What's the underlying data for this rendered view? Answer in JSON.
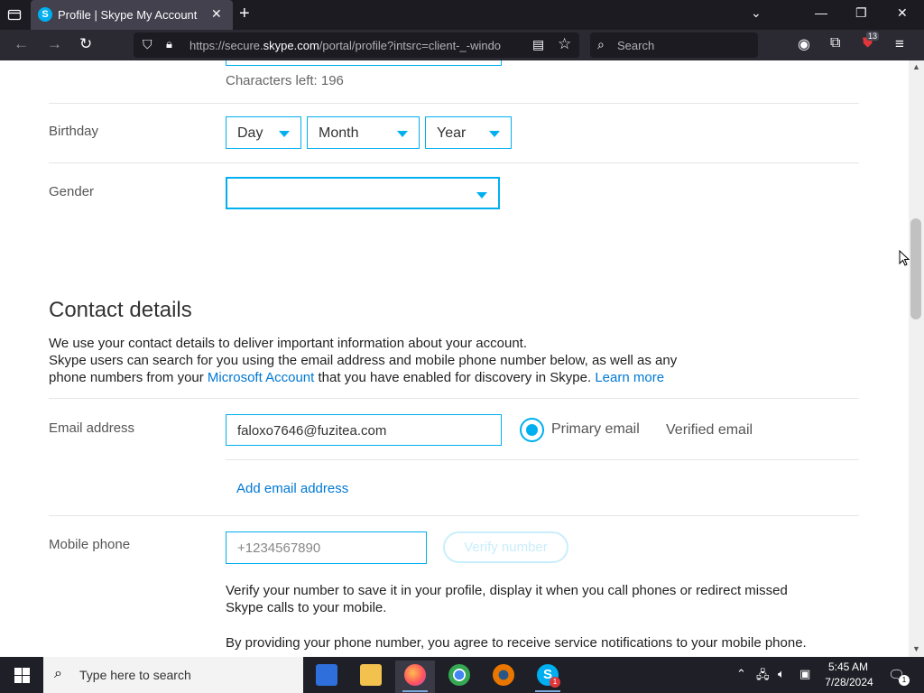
{
  "browser": {
    "tab_title": "Profile | Skype My Account",
    "url_prefix": "https://secure.",
    "url_domain": "skype.com",
    "url_suffix": "/portal/profile?intsrc=client-_-windo",
    "search_placeholder": "Search",
    "extension_badge": "13"
  },
  "profile": {
    "characters_left": "Characters left: 196",
    "birthday_label": "Birthday",
    "birthday_day": "Day",
    "birthday_month": "Month",
    "birthday_year": "Year",
    "gender_label": "Gender",
    "gender_value": ""
  },
  "contact": {
    "heading": "Contact details",
    "line1": "We use your contact details to deliver important information about your account.",
    "line2": "Skype users can search for you using the email address and mobile phone number below, as well as any",
    "line3_pre": "phone numbers from your ",
    "line3_link": "Microsoft Account",
    "line3_mid": " that you have enabled for discovery in Skype. ",
    "line3_link2": "Learn more",
    "email_label": "Email address",
    "email_value": "faloxo7646@fuzitea.com",
    "primary_email": "Primary email",
    "verified_email": "Verified email",
    "add_email": "Add email address",
    "mobile_label": "Mobile phone",
    "mobile_placeholder": "+1234567890",
    "verify_button": "Verify number",
    "verify_text1": "Verify your number to save it in your profile, display it when you call phones or redirect missed",
    "verify_text2": "Skype calls to your mobile.",
    "notice_text": "By providing your phone number, you agree to receive service notifications to your mobile phone."
  },
  "taskbar": {
    "search_placeholder": "Type here to search",
    "time": "5:45 AM",
    "date": "7/28/2024",
    "skype_badge": "1",
    "notification_count": "1"
  }
}
